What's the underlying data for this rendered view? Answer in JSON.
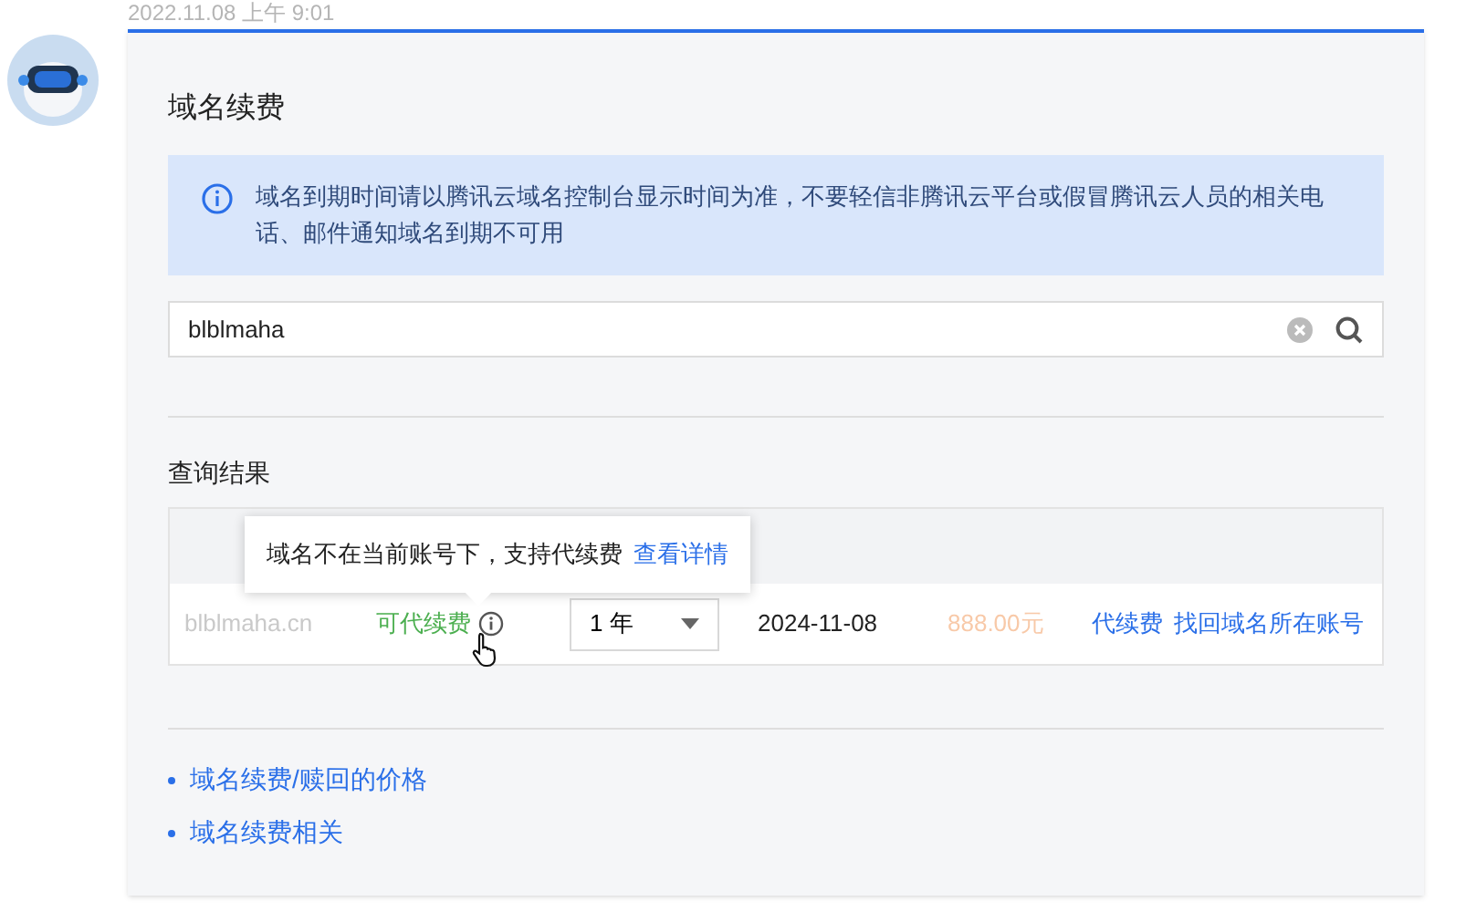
{
  "timestamp": "2022.11.08 上午 9:01",
  "card": {
    "title": "域名续费",
    "alert": "域名到期时间请以腾讯云域名控制台显示时间为准，不要轻信非腾讯云平台或假冒腾讯云人员的相关电话、邮件通知域名到期不可用",
    "search": {
      "value": "blblmaha"
    },
    "results_title": "查询结果",
    "tooltip": {
      "text": "域名不在当前账号下，支持代续费",
      "link": "查看详情"
    },
    "rows": [
      {
        "domain": "blblmaha.cn",
        "status": "可代续费",
        "period": "1 年",
        "expiry": "2024-11-08",
        "price": "888.00元",
        "actions": [
          "代续费",
          "找回域名所在账号"
        ]
      }
    ],
    "links": [
      "域名续费/赎回的价格",
      "域名续费相关"
    ]
  }
}
